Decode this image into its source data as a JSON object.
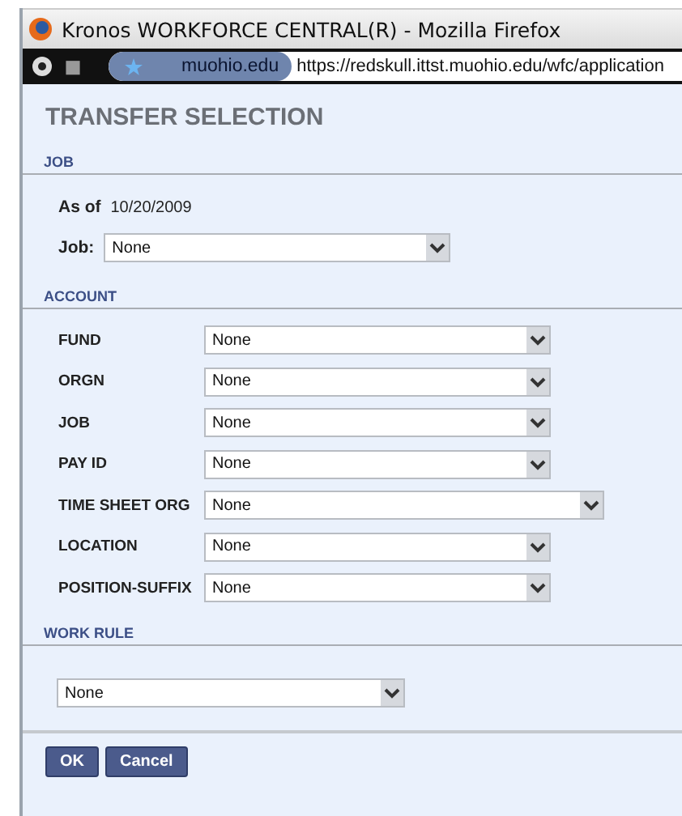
{
  "window": {
    "title": "Kronos WORKFORCE CENTRAL(R) - Mozilla Firefox"
  },
  "toolbar": {
    "site": "muohio.edu",
    "url": "https://redskull.ittst.muohio.edu/wfc/application"
  },
  "page_title": "TRANSFER SELECTION",
  "job_section": {
    "heading": "JOB",
    "as_of_label": "As of",
    "as_of_date": "10/20/2009",
    "job_label": "Job:",
    "job_value": "None"
  },
  "account_section": {
    "heading": "ACCOUNT",
    "fields": [
      {
        "label": "FUND",
        "value": "None",
        "kind": "normal"
      },
      {
        "label": "ORGN",
        "value": "None",
        "kind": "normal"
      },
      {
        "label": "JOB",
        "value": "None",
        "kind": "normal"
      },
      {
        "label": "PAY ID",
        "value": "None",
        "kind": "normal"
      },
      {
        "label": "TIME SHEET ORG",
        "value": "None",
        "kind": "wide"
      },
      {
        "label": "LOCATION",
        "value": "None",
        "kind": "normal"
      },
      {
        "label": "POSITION-SUFFIX",
        "value": "None",
        "kind": "normal"
      }
    ]
  },
  "work_rule_section": {
    "heading": "WORK RULE",
    "value": "None"
  },
  "buttons": [
    "OK",
    "Cancel"
  ]
}
